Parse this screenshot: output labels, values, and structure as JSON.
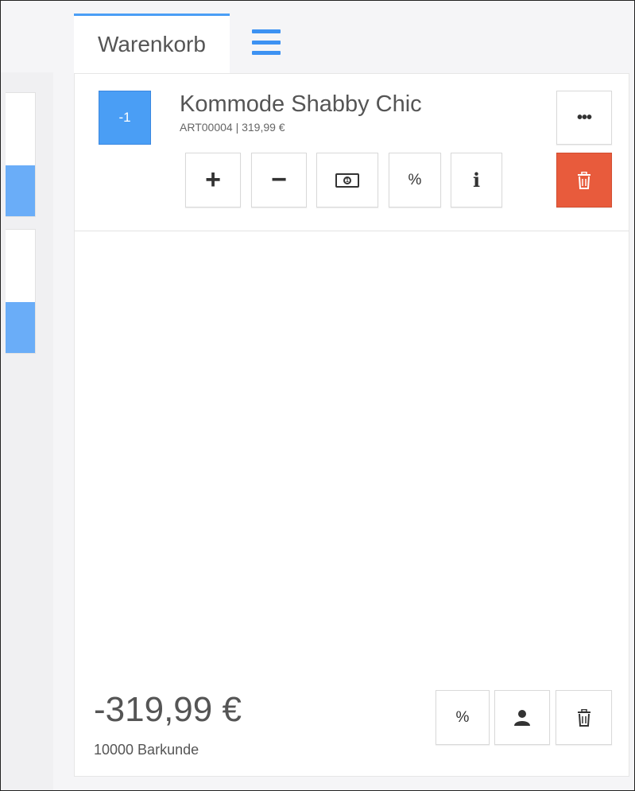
{
  "tabs": {
    "cart_label": "Warenkorb"
  },
  "menu_icon": "hamburger-menu-icon",
  "cart_item": {
    "quantity": "-1",
    "name": "Kommode Shabby Chic",
    "meta": "ART00004 | 319,99 €",
    "buttons": {
      "increase": "+",
      "decrease": "−",
      "cash_icon": "banknote-icon",
      "discount": "%",
      "info": "i",
      "more": "•••",
      "delete_icon": "trash-icon"
    }
  },
  "footer": {
    "total": "-319,99 €",
    "customer": "10000 Barkunde",
    "discount": "%",
    "customer_icon": "user-icon",
    "clear_icon": "trash-icon"
  },
  "colors": {
    "accent": "#4a9ef5",
    "delete": "#e85b3c"
  }
}
